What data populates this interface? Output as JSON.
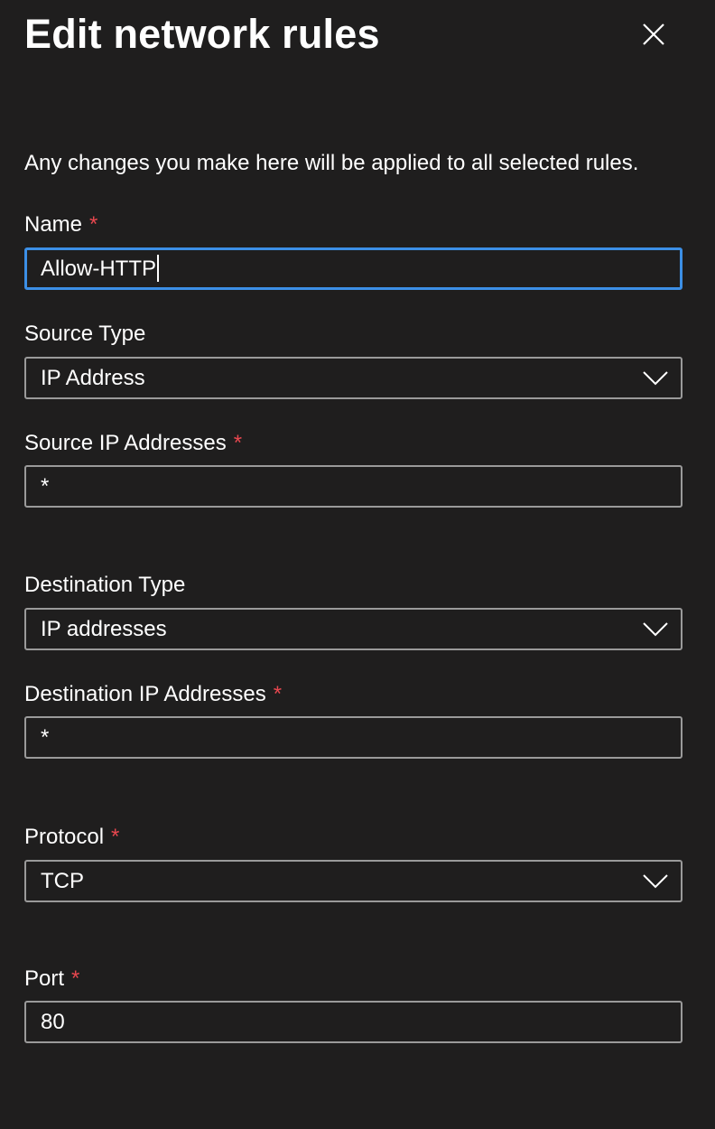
{
  "panel": {
    "title": "Edit network rules",
    "intro": "Any changes you make here will be applied to all selected rules."
  },
  "icons": {
    "close": "close-icon",
    "dropdown": "chevron-down-icon"
  },
  "colors": {
    "background": "#1f1e1e",
    "required": "#e8474f",
    "focus_border": "#3c8fe6",
    "field_border": "#9a9a9a"
  },
  "fields": {
    "name": {
      "label": "Name",
      "required_mark": "*",
      "value": "Allow-HTTP"
    },
    "source_type": {
      "label": "Source Type",
      "value": "IP Address"
    },
    "source_ip": {
      "label": "Source IP Addresses",
      "required_mark": "*",
      "value": "*"
    },
    "destination_type": {
      "label": "Destination Type",
      "value": "IP addresses"
    },
    "destination_ip": {
      "label": "Destination IP Addresses",
      "required_mark": "*",
      "value": "*"
    },
    "protocol": {
      "label": "Protocol",
      "required_mark": "*",
      "value": "TCP"
    },
    "port": {
      "label": "Port",
      "required_mark": "*",
      "value": "80"
    }
  }
}
